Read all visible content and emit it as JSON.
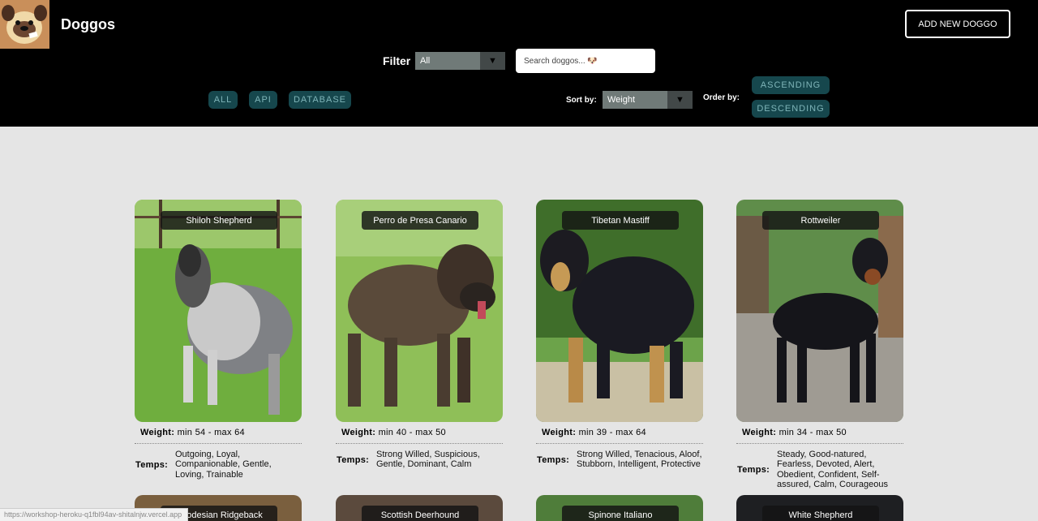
{
  "header": {
    "brand": "Doggos",
    "add_button": "ADD NEW DOGGO",
    "filter_label": "Filter",
    "filter_select": "All",
    "search_placeholder": "Search doggos... 🐶",
    "source_pills": [
      "ALL",
      "API",
      "DATABASE"
    ],
    "sort_label": "Sort by:",
    "sort_select": "Weight",
    "order_label": "Order by:",
    "order_buttons": [
      "ASCENDING",
      "DESCENDING"
    ]
  },
  "cards": [
    {
      "name": "Shiloh Shepherd",
      "weight_label": "Weight:",
      "weight": "min 54 - max 64",
      "temps_label": "Temps:",
      "temps": "Outgoing, Loyal, Companionable, Gentle, Loving, Trainable"
    },
    {
      "name": "Perro de Presa Canario",
      "weight_label": "Weight:",
      "weight": "min 40 - max 50",
      "temps_label": "Temps:",
      "temps": "Strong Willed, Suspicious, Gentle, Dominant, Calm"
    },
    {
      "name": "Tibetan Mastiff",
      "weight_label": "Weight:",
      "weight": "min 39 - max 64",
      "temps_label": "Temps:",
      "temps": "Strong Willed, Tenacious, Aloof, Stubborn, Intelligent, Protective"
    },
    {
      "name": "Rottweiler",
      "weight_label": "Weight:",
      "weight": "min 34 - max 50",
      "temps_label": "Temps:",
      "temps": "Steady, Good-natured, Fearless, Devoted, Alert, Obedient, Confident, Self-assured, Calm, Courageous"
    }
  ],
  "bottom_cards": [
    "Rhodesian Ridgeback",
    "Scottish Deerhound",
    "Spinone Italiano",
    "White Shepherd"
  ],
  "status_url": "https://workshop-heroku-q1fbl94av-shitalnjw.vercel.app",
  "colors": {
    "header_bg": "#000000",
    "page_bg": "#e5e5e5",
    "pill_bg": "#16474d",
    "pill_text": "#7fb5b9"
  }
}
